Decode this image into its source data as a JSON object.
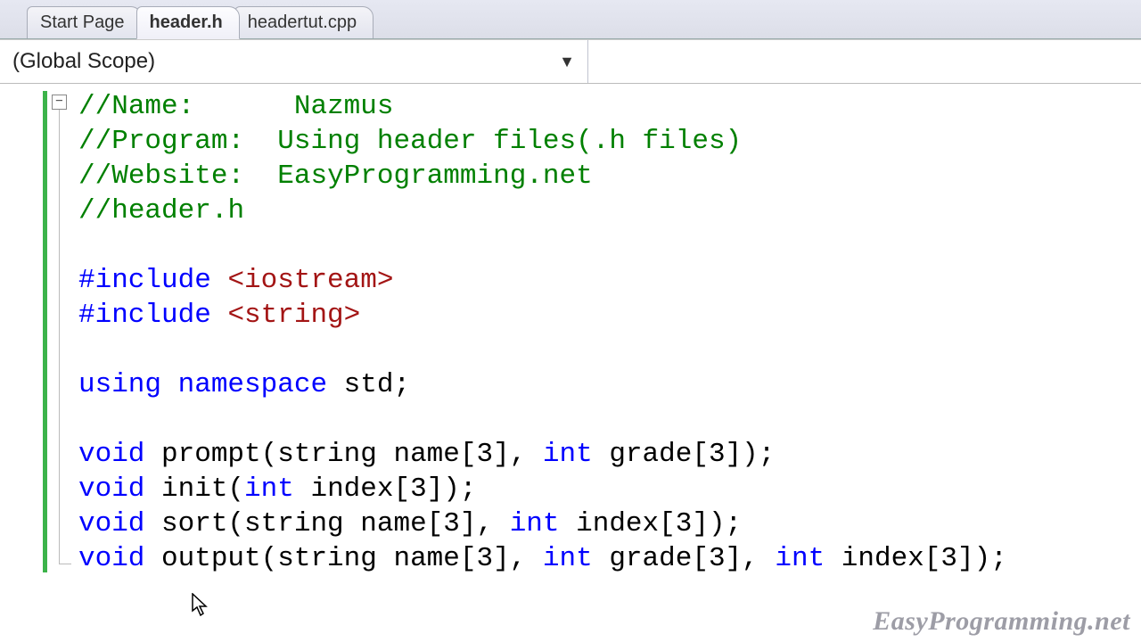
{
  "tabs": [
    {
      "label": "Start Page",
      "active": false
    },
    {
      "label": "header.h",
      "active": true
    },
    {
      "label": "headertut.cpp",
      "active": false
    }
  ],
  "scope": {
    "label": "(Global Scope)"
  },
  "code": {
    "l1": {
      "slashes": "//",
      "key": "Name:",
      "pad": "      ",
      "val": "Nazmus"
    },
    "l2": {
      "slashes": "//",
      "key": "Program:",
      "pad": "  ",
      "val": "Using header files(.h files)"
    },
    "l3": {
      "slashes": "//",
      "key": "Website:",
      "pad": "  ",
      "val": "EasyProgramming.net"
    },
    "l4": {
      "slashes": "//",
      "val": "header.h"
    },
    "inc1": {
      "pp": "#include ",
      "hdr": "<iostream>"
    },
    "inc2": {
      "pp": "#include ",
      "hdr": "<string>"
    },
    "using": {
      "kw1": "using",
      "sp1": " ",
      "kw2": "namespace",
      "sp2": " ",
      "id": "std",
      "semi": ";"
    },
    "f1": {
      "kw": "void",
      "name": " prompt(string name[3], ",
      "kw2": "int",
      "rest": " grade[3]);"
    },
    "f2": {
      "kw": "void",
      "name": " init(",
      "kw2": "int",
      "rest": " index[3]);"
    },
    "f3": {
      "kw": "void",
      "name": " sort(string name[3], ",
      "kw2": "int",
      "rest": " index[3]);"
    },
    "f4": {
      "kw": "void",
      "name": " output(string name[3], ",
      "kw2": "int",
      "mid": " grade[3], ",
      "kw3": "int",
      "rest": " index[3]);"
    }
  },
  "fold": {
    "symbol": "−"
  },
  "watermark": "EasyProgramming.net"
}
